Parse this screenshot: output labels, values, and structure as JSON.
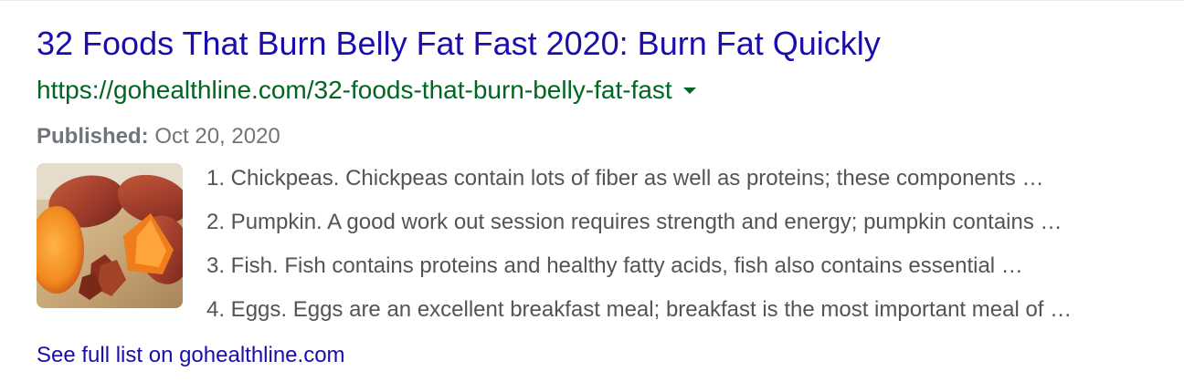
{
  "result": {
    "title": "32 Foods That Burn Belly Fat Fast 2020: Burn Fat Quickly",
    "url": "https://gohealthline.com/32-foods-that-burn-belly-fat-fast",
    "url_menu_icon": "caret-down-icon",
    "published_label": "Published:",
    "published_date": "Oct 20, 2020",
    "thumbnail_icon": "sweet-potato-thumbnail",
    "list_items": [
      "1. Chickpeas. Chickpeas contain lots of fiber as well as proteins; these components …",
      "2. Pumpkin. A good work out session requires strength and energy; pumpkin contains …",
      "3. Fish. Fish contains proteins and healthy fatty acids, fish also contains essential …",
      "4. Eggs. Eggs are an excellent breakfast meal; breakfast is the most important meal of …"
    ],
    "see_full_list": "See full list on gohealthline.com"
  },
  "colors": {
    "title": "#1a0dab",
    "url": "#006621",
    "snippet": "#545454",
    "meta": "#70757a"
  }
}
